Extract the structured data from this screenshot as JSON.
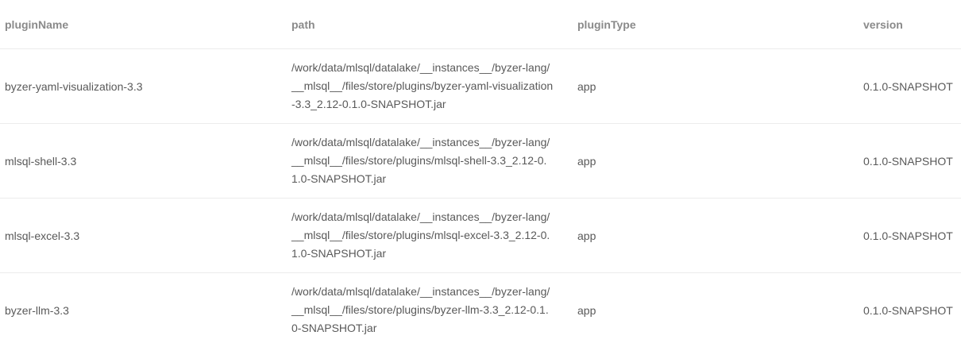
{
  "table": {
    "headers": [
      "pluginName",
      "path",
      "pluginType",
      "version"
    ],
    "rows": [
      {
        "pluginName": "byzer-yaml-visualization-3.3",
        "path_lines": [
          "/work/data/mlsql/datalake/__instances__/byzer-lang/",
          "__mlsql__/files/store/plugins/byzer-yaml-visualization",
          "-3.3_2.12-0.1.0-SNAPSHOT.jar"
        ],
        "pluginType": "app",
        "version": "0.1.0-SNAPSHOT"
      },
      {
        "pluginName": "mlsql-shell-3.3",
        "path_lines": [
          "/work/data/mlsql/datalake/__instances__/byzer-lang/",
          "__mlsql__/files/store/plugins/mlsql-shell-3.3_2.12-0.",
          "1.0-SNAPSHOT.jar"
        ],
        "pluginType": "app",
        "version": "0.1.0-SNAPSHOT"
      },
      {
        "pluginName": "mlsql-excel-3.3",
        "path_lines": [
          "/work/data/mlsql/datalake/__instances__/byzer-lang/",
          "__mlsql__/files/store/plugins/mlsql-excel-3.3_2.12-0.",
          "1.0-SNAPSHOT.jar"
        ],
        "pluginType": "app",
        "version": "0.1.0-SNAPSHOT"
      },
      {
        "pluginName": "byzer-llm-3.3",
        "path_lines": [
          "/work/data/mlsql/datalake/__instances__/byzer-lang/",
          "__mlsql__/files/store/plugins/byzer-llm-3.3_2.12-0.1.",
          "0-SNAPSHOT.jar"
        ],
        "pluginType": "app",
        "version": "0.1.0-SNAPSHOT"
      }
    ]
  }
}
